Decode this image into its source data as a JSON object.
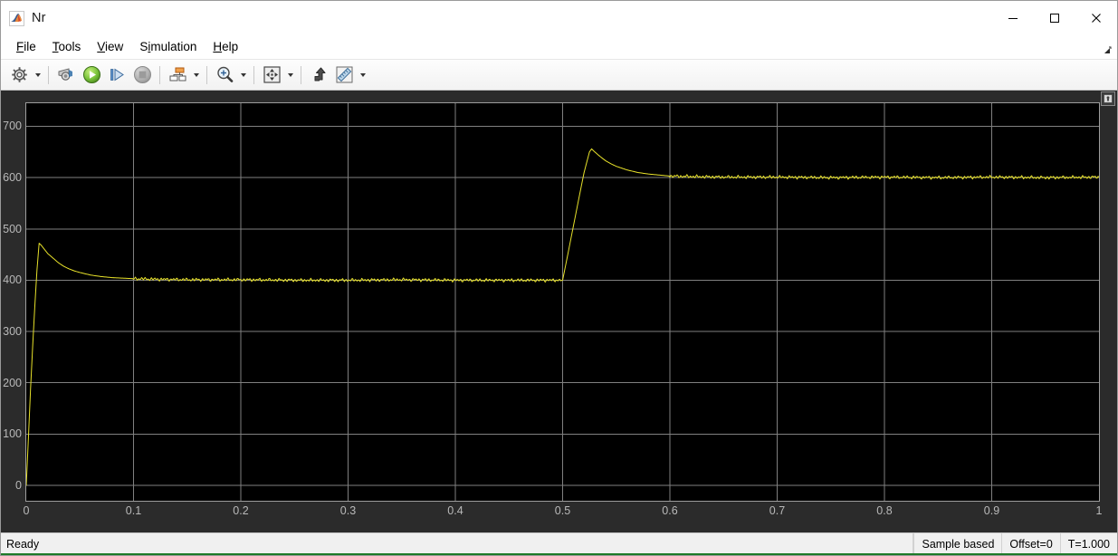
{
  "window": {
    "title": "Nr",
    "app_icon": "matlab-membrane-icon",
    "controls": [
      {
        "name": "minimize",
        "glyph": "minimize-icon"
      },
      {
        "name": "maximize",
        "glyph": "maximize-icon"
      },
      {
        "name": "close",
        "glyph": "close-icon"
      }
    ]
  },
  "menubar": {
    "items": [
      {
        "label": "File",
        "mnemonic": "F"
      },
      {
        "label": "Tools",
        "mnemonic": "T"
      },
      {
        "label": "View",
        "mnemonic": "V"
      },
      {
        "label": "Simulation",
        "mnemonic": "i"
      },
      {
        "label": "Help",
        "mnemonic": "H"
      }
    ],
    "resize_grip": "resize-grip-icon"
  },
  "toolbar": {
    "buttons": [
      {
        "name": "configuration-properties",
        "icon": "gear-icon",
        "dropdown": true
      },
      {
        "name": "print",
        "icon": "print-icon",
        "dropdown": false
      },
      {
        "name": "run",
        "icon": "run-play-icon",
        "dropdown": false
      },
      {
        "name": "step-forward",
        "icon": "step-forward-icon",
        "dropdown": false
      },
      {
        "name": "stop",
        "icon": "stop-icon",
        "dropdown": false
      },
      {
        "name": "signal-selection",
        "icon": "signal-blocks-icon",
        "dropdown": true
      },
      {
        "name": "zoom",
        "icon": "zoom-magnifier-icon",
        "dropdown": true
      },
      {
        "name": "autoscale",
        "icon": "autoscale-arrows-icon",
        "dropdown": true
      },
      {
        "name": "style",
        "icon": "style-lightning-icon",
        "dropdown": false
      },
      {
        "name": "measurements",
        "icon": "ruler-icon",
        "dropdown": true
      }
    ]
  },
  "plot": {
    "float_button": "undock-icon",
    "background": "#000000",
    "grid_color": "#808080",
    "axis_frame_color": "#9d9d9d",
    "margin_color": "#2b2b2b"
  },
  "statusbar": {
    "ready": "Ready",
    "cells": [
      {
        "name": "frame-type",
        "text": "Sample based"
      },
      {
        "name": "offset",
        "text": "Offset=0"
      },
      {
        "name": "time",
        "text": "T=1.000"
      }
    ]
  },
  "chart_data": {
    "type": "line",
    "title": "Nr",
    "xlabel": "",
    "ylabel": "",
    "xlim": [
      0,
      1
    ],
    "ylim": [
      -30,
      745
    ],
    "xticks": [
      0,
      0.1,
      0.2,
      0.3,
      0.4,
      0.5,
      0.6,
      0.7,
      0.8,
      0.9,
      1
    ],
    "xticklabels": [
      "0",
      "0.1",
      "0.2",
      "0.3",
      "0.4",
      "0.5",
      "0.6",
      "0.7",
      "0.8",
      "0.9",
      "1"
    ],
    "yticks": [
      0,
      100,
      200,
      300,
      400,
      500,
      600,
      700
    ],
    "yticklabels": [
      "0",
      "100",
      "200",
      "300",
      "400",
      "500",
      "600",
      "700"
    ],
    "grid": true,
    "legend": null,
    "series": [
      {
        "name": "Nr",
        "color": "#e8e22a",
        "linewidth": 1,
        "description": "Rotor speed step response: rises from 0 to overshoot 472 at t=0.012, settles to 400; at t=0.50 steps up, overshoots to 656 at t=0.527, settles to 600",
        "x": [
          0,
          0.002,
          0.004,
          0.006,
          0.008,
          0.01,
          0.012,
          0.014,
          0.017,
          0.02,
          0.025,
          0.03,
          0.035,
          0.04,
          0.045,
          0.05,
          0.06,
          0.07,
          0.08,
          0.09,
          0.1,
          0.12,
          0.15,
          0.2,
          0.25,
          0.3,
          0.35,
          0.4,
          0.45,
          0.499,
          0.5,
          0.505,
          0.51,
          0.515,
          0.52,
          0.525,
          0.527,
          0.53,
          0.535,
          0.54,
          0.545,
          0.55,
          0.56,
          0.57,
          0.58,
          0.59,
          0.6,
          0.62,
          0.65,
          0.7,
          0.75,
          0.8,
          0.85,
          0.9,
          0.95,
          1.0
        ],
        "y": [
          0,
          92,
          188,
          272,
          350,
          420,
          472,
          468,
          460,
          452,
          443,
          434,
          427,
          422,
          418,
          415,
          410,
          407,
          405,
          404,
          403,
          402,
          401,
          401,
          400,
          400,
          401,
          400,
          400,
          400,
          400,
          452,
          505,
          558,
          610,
          650,
          656,
          650,
          641,
          633,
          627,
          622,
          615,
          610,
          607,
          605,
          603,
          602,
          601,
          601,
          600,
          601,
          600,
          601,
          600,
          601
        ]
      }
    ]
  }
}
